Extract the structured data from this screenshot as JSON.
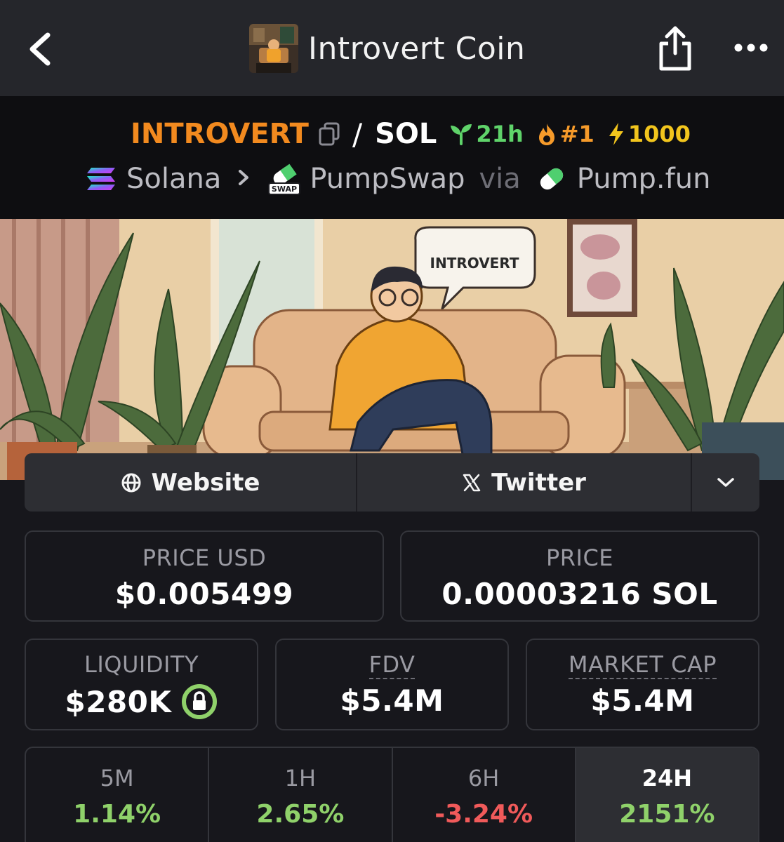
{
  "header": {
    "title": "Introvert Coin",
    "back_icon": "chevron-left-icon",
    "share_icon": "share-icon",
    "more_icon": "more-horizontal-icon"
  },
  "pair": {
    "base_symbol": "INTROVERT",
    "separator": "/",
    "quote_symbol": "SOL",
    "age": "21h",
    "rank": "#1",
    "boost": "1000",
    "colors": {
      "base": "#f28a1f",
      "age": "#5fd36a",
      "rank": "#f59a2a",
      "boost": "#f2c51d"
    }
  },
  "chain": {
    "network": "Solana",
    "dex": "PumpSwap",
    "via_label": "via",
    "launchpad": "Pump.fun",
    "dex_icon_text": "SWAP"
  },
  "banner": {
    "speech_text": "INTROVERT"
  },
  "links": {
    "website_label": "Website",
    "twitter_label": "Twitter"
  },
  "stats": {
    "price_usd_label": "PRICE USD",
    "price_usd_value": "$0.005499",
    "price_label": "PRICE",
    "price_value": "0.00003216 SOL",
    "liquidity_label": "LIQUIDITY",
    "liquidity_value": "$280K",
    "fdv_label": "FDV",
    "fdv_value": "$5.4M",
    "mcap_label": "MARKET CAP",
    "mcap_value": "$5.4M"
  },
  "timeframes": [
    {
      "label": "5M",
      "change": "1.14%",
      "direction": "up"
    },
    {
      "label": "1H",
      "change": "2.65%",
      "direction": "up"
    },
    {
      "label": "6H",
      "change": "-3.24%",
      "direction": "down"
    },
    {
      "label": "24H",
      "change": "2151%",
      "direction": "up",
      "selected": true
    }
  ]
}
